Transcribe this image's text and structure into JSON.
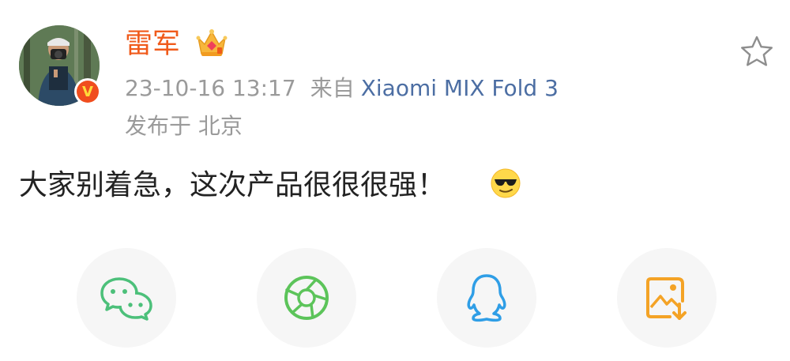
{
  "post": {
    "username": "雷军",
    "timestamp": "23-10-16 13:17",
    "source_prefix": "来自",
    "device": "Xiaomi MIX Fold 3",
    "location": "发布于 北京",
    "content": "大家别着急，这次产品很很很强！"
  },
  "icons": {
    "avatar": "avatar-photo",
    "verified": "verified-v-badge",
    "member": "crown-icon",
    "favorite": "star-icon",
    "emoji": "sunglasses-emoji"
  },
  "verified_letter": "V",
  "share": [
    {
      "name": "wechat",
      "icon": "wechat-icon",
      "color": "#4cc07a"
    },
    {
      "name": "moments",
      "icon": "moments-aperture-icon",
      "color": "#5cc45a"
    },
    {
      "name": "qq",
      "icon": "qq-penguin-icon",
      "color": "#2f9ee6"
    },
    {
      "name": "save-image",
      "icon": "save-image-icon",
      "color": "#f4a326"
    }
  ],
  "colors": {
    "username": "#f05a1a",
    "meta": "#9a9a9a",
    "device_link": "#4c6ea3",
    "text": "#222222",
    "share_bg": "#f6f6f6"
  }
}
